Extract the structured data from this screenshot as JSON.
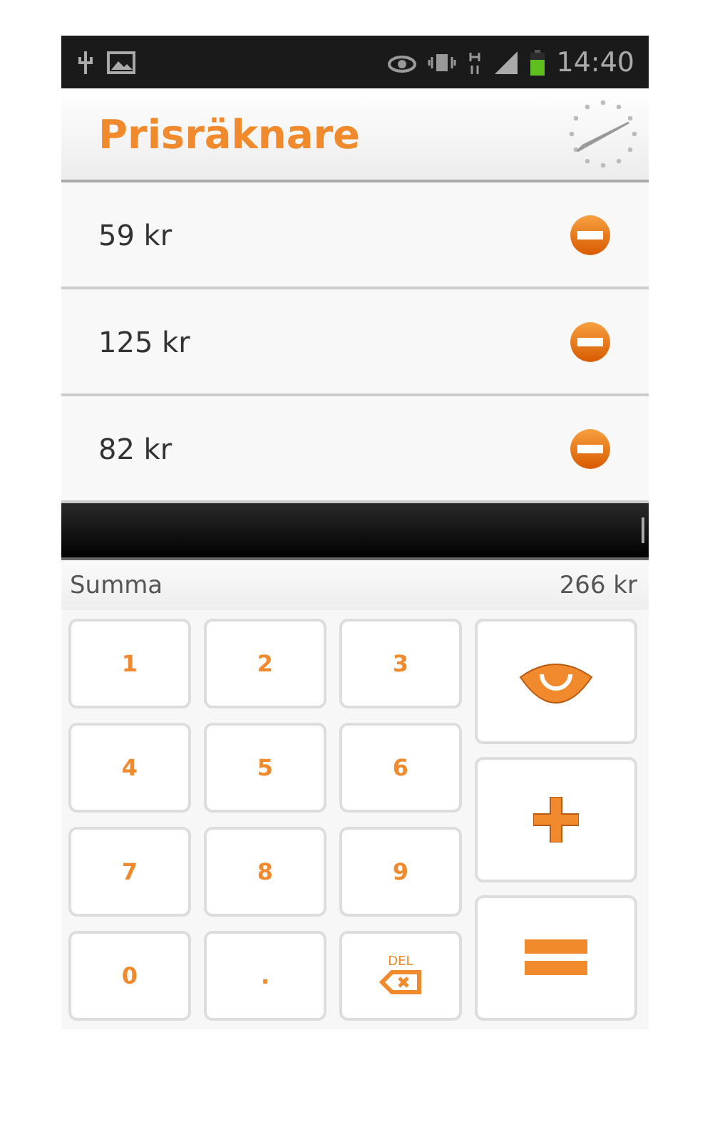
{
  "status_bar": {
    "time": "14:40"
  },
  "app_bar": {
    "title": "Prisräknare"
  },
  "items": [
    {
      "price": "59 kr"
    },
    {
      "price": "125 kr"
    },
    {
      "price": "82 kr"
    }
  ],
  "total": {
    "label": "Summa",
    "value": "266 kr"
  },
  "keys": [
    {
      "kind": "digit",
      "label": "1"
    },
    {
      "kind": "digit",
      "label": "2"
    },
    {
      "kind": "digit",
      "label": "3"
    },
    {
      "kind": "digit",
      "label": "4"
    },
    {
      "kind": "digit",
      "label": "5"
    },
    {
      "kind": "digit",
      "label": "6"
    },
    {
      "kind": "digit",
      "label": "7"
    },
    {
      "kind": "digit",
      "label": "8"
    },
    {
      "kind": "digit",
      "label": "9"
    },
    {
      "kind": "digit",
      "label": "0"
    },
    {
      "kind": "digit",
      "label": "."
    },
    {
      "kind": "delete",
      "label": "DEL"
    }
  ],
  "side_keys": [
    {
      "kind": "eye"
    },
    {
      "kind": "plus"
    },
    {
      "kind": "equals"
    }
  ]
}
